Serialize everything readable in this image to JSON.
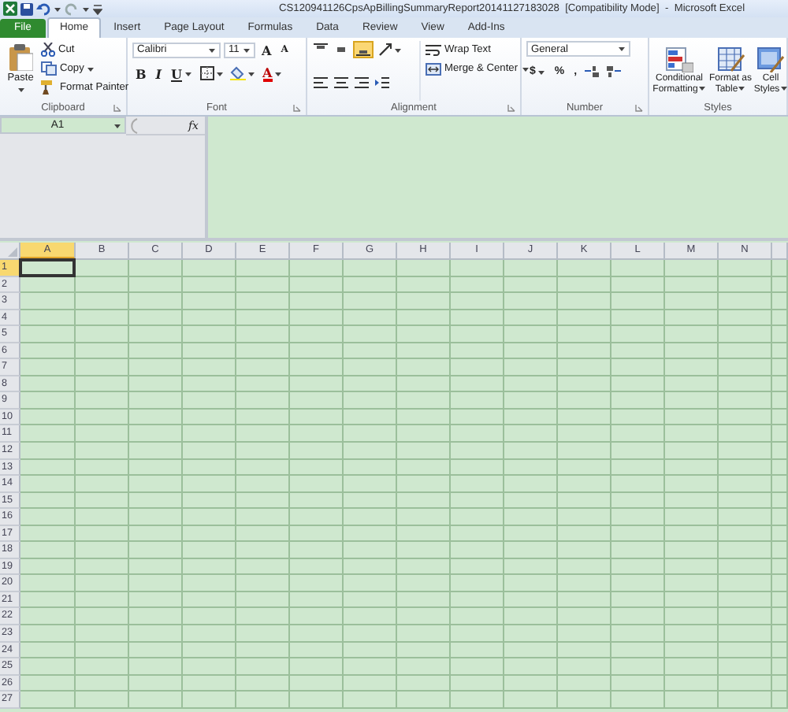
{
  "window": {
    "title": "CS120941126CpsApBillingSummaryReport20141127183028  [Compatibility Mode]  -  Microsoft Excel"
  },
  "tabs": [
    {
      "label": "File",
      "kind": "file",
      "selected": false
    },
    {
      "label": "Home",
      "kind": "tab",
      "selected": true
    },
    {
      "label": "Insert",
      "kind": "tab",
      "selected": false
    },
    {
      "label": "Page Layout",
      "kind": "tab",
      "selected": false
    },
    {
      "label": "Formulas",
      "kind": "tab",
      "selected": false
    },
    {
      "label": "Data",
      "kind": "tab",
      "selected": false
    },
    {
      "label": "Review",
      "kind": "tab",
      "selected": false
    },
    {
      "label": "View",
      "kind": "tab",
      "selected": false
    },
    {
      "label": "Add-Ins",
      "kind": "tab",
      "selected": false
    }
  ],
  "ribbon": [
    {
      "label": "Clipboard",
      "columns": [
        [
          {
            "kind": "big",
            "label": "Paste",
            "menu": true
          }
        ],
        [
          {
            "kind": "small",
            "label": "Cut"
          },
          {
            "kind": "small",
            "label": "Copy",
            "menu": true
          },
          {
            "kind": "small",
            "label": "Format Painter"
          }
        ]
      ]
    },
    {
      "label": "Font",
      "columns": [
        [
          {
            "kind": "combo",
            "value": "Calibri",
            "wide": true
          },
          {
            "kind": "combo",
            "value": "11"
          },
          {
            "kind": "glyph",
            "label": "A"
          },
          {
            "kind": "glyph",
            "label": "A"
          }
        ],
        [
          {
            "kind": "glyph",
            "label": "B"
          },
          {
            "kind": "glyph",
            "label": "I"
          },
          {
            "kind": "glyph",
            "label": "U",
            "menu": true
          },
          {
            "kind": "icon",
            "menu": true
          },
          {
            "kind": "icon",
            "menu": true
          },
          {
            "kind": "glyph",
            "label": "A",
            "menu": true
          }
        ]
      ]
    },
    {
      "label": "Alignment",
      "columns": [
        [
          {
            "kind": "icon",
            "selected": false
          },
          {
            "kind": "icon",
            "selected": false
          },
          {
            "kind": "icon",
            "selected": true
          },
          {
            "kind": "icon",
            "menu": true
          }
        ],
        [
          {
            "kind": "icon"
          },
          {
            "kind": "icon"
          },
          {
            "kind": "icon"
          },
          {
            "kind": "icon"
          }
        ],
        [
          {
            "kind": "small",
            "label": "Wrap Text"
          },
          {
            "kind": "small",
            "label": "Merge & Center",
            "menu": true
          }
        ]
      ]
    },
    {
      "label": "Number",
      "columns": [
        [
          {
            "kind": "combo",
            "value": "General",
            "wide": true
          }
        ],
        [
          {
            "kind": "glyph",
            "label": "$",
            "menu": true
          },
          {
            "kind": "glyph",
            "label": "%"
          },
          {
            "kind": "glyph",
            "label": ","
          },
          {
            "kind": "icon"
          },
          {
            "kind": "icon"
          }
        ]
      ]
    },
    {
      "label": "Styles",
      "columns": [
        [
          {
            "kind": "big",
            "label": "Conditional Formatting",
            "menu": true
          },
          {
            "kind": "big",
            "label": "Format as Table",
            "menu": true
          },
          {
            "kind": "big",
            "label": "Cell Styles",
            "menu": true
          }
        ]
      ]
    }
  ],
  "name_box": {
    "value": "A1"
  },
  "formula_bar": {
    "function_label": "fx"
  },
  "columns": [
    {
      "label": "A",
      "selected": true
    },
    {
      "label": "B",
      "selected": false
    },
    {
      "label": "C",
      "selected": false
    },
    {
      "label": "D",
      "selected": false
    },
    {
      "label": "E",
      "selected": false
    },
    {
      "label": "F",
      "selected": false
    },
    {
      "label": "G",
      "selected": false
    },
    {
      "label": "H",
      "selected": false
    },
    {
      "label": "I",
      "selected": false
    },
    {
      "label": "J",
      "selected": false
    },
    {
      "label": "K",
      "selected": false
    },
    {
      "label": "L",
      "selected": false
    },
    {
      "label": "M",
      "selected": false
    },
    {
      "label": "N",
      "selected": false
    }
  ],
  "rows": [
    {
      "label": "1",
      "selected": true
    },
    {
      "label": "2",
      "selected": false
    },
    {
      "label": "3",
      "selected": false
    },
    {
      "label": "4",
      "selected": false
    },
    {
      "label": "5",
      "selected": false
    },
    {
      "label": "6",
      "selected": false
    },
    {
      "label": "7",
      "selected": false
    },
    {
      "label": "8",
      "selected": false
    },
    {
      "label": "9",
      "selected": false
    },
    {
      "label": "10",
      "selected": false
    },
    {
      "label": "11",
      "selected": false
    },
    {
      "label": "12",
      "selected": false
    },
    {
      "label": "13",
      "selected": false
    },
    {
      "label": "14",
      "selected": false
    },
    {
      "label": "15",
      "selected": false
    },
    {
      "label": "16",
      "selected": false
    },
    {
      "label": "17",
      "selected": false
    },
    {
      "label": "18",
      "selected": false
    },
    {
      "label": "19",
      "selected": false
    },
    {
      "label": "20",
      "selected": false
    },
    {
      "label": "21",
      "selected": false
    },
    {
      "label": "22",
      "selected": false
    },
    {
      "label": "23",
      "selected": false
    },
    {
      "label": "24",
      "selected": false
    },
    {
      "label": "25",
      "selected": false
    },
    {
      "label": "26",
      "selected": false
    },
    {
      "label": "27",
      "selected": false
    }
  ]
}
